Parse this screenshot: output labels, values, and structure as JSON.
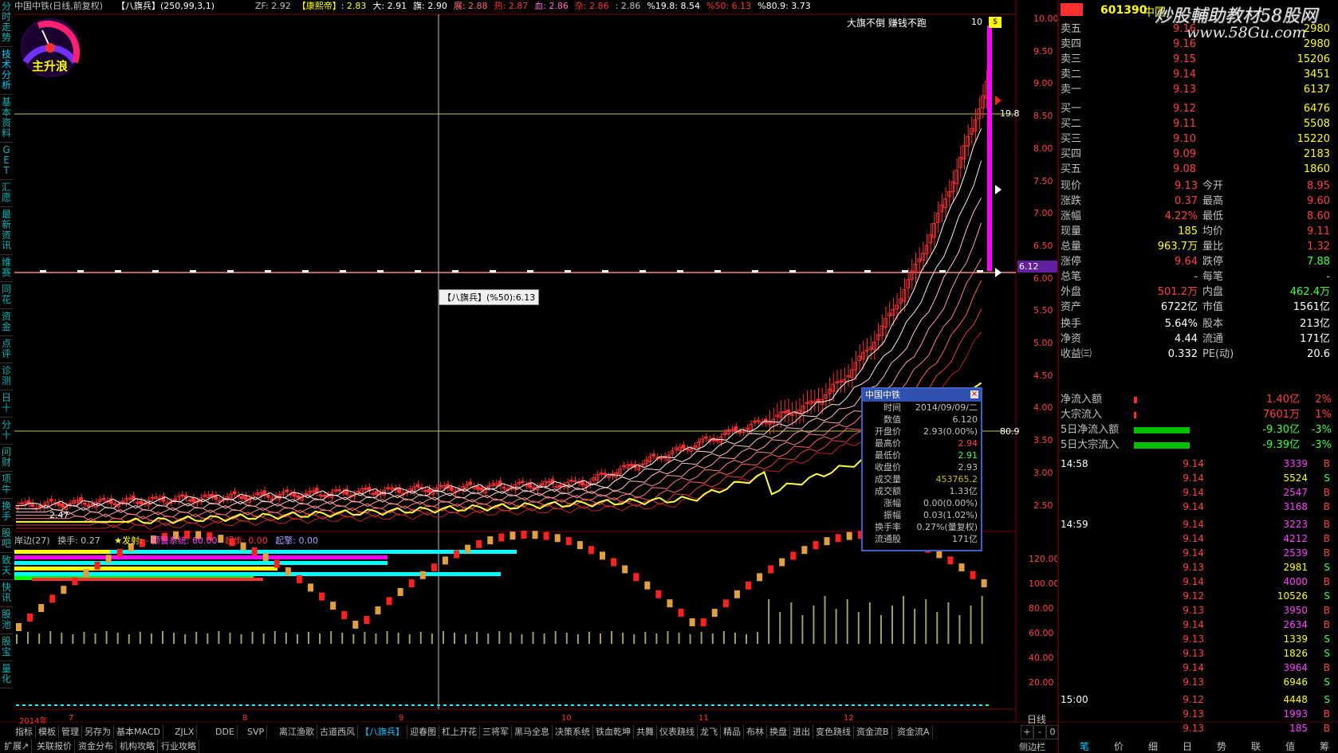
{
  "header": {
    "stock": "中国中铁(日线,前复权)",
    "indicator": "【八旗兵】(250,99,3,1)",
    "values": [
      {
        "label": "ZF",
        "value": "2.92",
        "color": "#c0c0c0"
      },
      {
        "label": "【康熙帝】",
        "value": "2.83",
        "color": "#ffff00"
      },
      {
        "label": "大",
        "value": "2.91",
        "color": "#ffffff"
      },
      {
        "label": "旗",
        "value": "2.90",
        "color": "#ffffff"
      },
      {
        "label": "展",
        "value": "2.88",
        "color": "#ff6666"
      },
      {
        "label": "热",
        "value": "2.87",
        "color": "#ff3030"
      },
      {
        "label": "血",
        "value": "2.86",
        "color": "#ff66cc"
      },
      {
        "label": "杂",
        "value": "2.86",
        "color": "#ff3030"
      },
      {
        "label": "",
        "value": "2.86",
        "color": "#c0c0c0"
      },
      {
        "label": "%19.8",
        "value": "8.54",
        "color": "#ffffff"
      },
      {
        "label": "%50",
        "value": "6.13",
        "color": "#ff3030"
      },
      {
        "label": "%80.9",
        "value": "3.73",
        "color": "#ffffff"
      }
    ]
  },
  "gauge": {
    "label": "主升浪"
  },
  "left_tabs": [
    "分时走势",
    "技术分析",
    "基本资料",
    "GET",
    "汇愿",
    "最新资讯",
    "维赛",
    "同花",
    "资金",
    "点评",
    "诊测",
    "日十",
    "分十",
    "问财",
    "项牛",
    "换手",
    "股吧",
    "致天",
    "快讯",
    "股池",
    "股宝",
    "量化"
  ],
  "price_axis": [
    "10.00",
    "9.50",
    "9.00",
    "8.50",
    "8.00",
    "7.50",
    "7.00",
    "6.50",
    "6.00",
    "5.50",
    "5.00",
    "4.50",
    "4.00",
    "3.50",
    "3.00",
    "2.50"
  ],
  "lower_axis": [
    "120.00",
    "100.00",
    "80.00",
    "60.00",
    "40.00",
    "20.00"
  ],
  "annotations": {
    "top_slogan": "大旗不倒 赚钱不跑",
    "max_label": "10",
    "max_tag": "$",
    "low_label": "2.47",
    "pct_19": "19.8",
    "pct_80": "80.9",
    "price_tag": "6.12",
    "crosshair_tip": "【八旗兵】(%50):6.13",
    "year_label": "2014年",
    "months": [
      "7",
      "8",
      "9",
      "10",
      "11",
      "12"
    ],
    "day_line": "日线"
  },
  "lower_header": {
    "a": "岸边(27)",
    "b": "换手: 0.27",
    "c": "★发射:",
    "d": "- 预警系统: 60.00",
    "e": "起步: 0.00",
    "f": "起擎: 0.00"
  },
  "popup": {
    "title": "中国中铁",
    "rows": [
      {
        "k": "时间",
        "v": "2014/09/09/二",
        "vc": "#c0c0c0"
      },
      {
        "k": "数值",
        "v": "6.120",
        "vc": "#c0c0c0"
      },
      {
        "k": "开盘价",
        "v": "2.93(0.00%)",
        "vc": "#c0c0c0"
      },
      {
        "k": "最高价",
        "v": "2.94",
        "vc": "#ff4040"
      },
      {
        "k": "最低价",
        "v": "2.91",
        "vc": "#40ff40"
      },
      {
        "k": "收盘价",
        "v": "2.93",
        "vc": "#c0c0c0"
      },
      {
        "k": "成交量",
        "v": "453765.2",
        "vc": "#c0c000"
      },
      {
        "k": "成交额",
        "v": "1.33亿",
        "vc": "#c0c0c0"
      },
      {
        "k": "涨幅",
        "v": "0.00(0.00%)",
        "vc": "#c0c0c0"
      },
      {
        "k": "振幅",
        "v": "0.03(1.02%)",
        "vc": "#c0c0c0"
      },
      {
        "k": "换手率",
        "v": "0.27%(量复权)",
        "vc": "#c0c0c0"
      },
      {
        "k": "流通股",
        "v": "171亿",
        "vc": "#c0c0c0"
      }
    ]
  },
  "quote": {
    "code": "601390",
    "name": "中国",
    "watermark_cn": "炒股輔助教材58股网",
    "watermark_url": "www.58Gu.com",
    "asks": [
      {
        "label": "卖五",
        "price": "9.16",
        "vol": "2980"
      },
      {
        "label": "卖四",
        "price": "9.16",
        "vol": "2980"
      },
      {
        "label": "卖三",
        "price": "9.15",
        "vol": "15206"
      },
      {
        "label": "卖二",
        "price": "9.14",
        "vol": "3451"
      },
      {
        "label": "卖一",
        "price": "9.13",
        "vol": "6137"
      }
    ],
    "bids": [
      {
        "label": "买一",
        "price": "9.12",
        "vol": "6476"
      },
      {
        "label": "买二",
        "price": "9.11",
        "vol": "5508"
      },
      {
        "label": "买三",
        "price": "9.10",
        "vol": "15220"
      },
      {
        "label": "买四",
        "price": "9.09",
        "vol": "2183"
      },
      {
        "label": "买五",
        "price": "9.08",
        "vol": "1860"
      }
    ],
    "stats": [
      {
        "l1": "现价",
        "v1": "9.13",
        "c1": "#ff4040",
        "l2": "今开",
        "v2": "8.95",
        "c2": "#ff4040"
      },
      {
        "l1": "涨跌",
        "v1": "0.37",
        "c1": "#ff4040",
        "l2": "最高",
        "v2": "9.60",
        "c2": "#ff4040"
      },
      {
        "l1": "涨幅",
        "v1": "4.22%",
        "c1": "#ff4040",
        "l2": "最低",
        "v2": "8.60",
        "c2": "#ff4040"
      },
      {
        "l1": "现量",
        "v1": "185",
        "c1": "#ffff00",
        "l2": "均价",
        "v2": "9.11",
        "c2": "#ff4040"
      },
      {
        "l1": "总量",
        "v1": "963.7万",
        "c1": "#ffff00",
        "l2": "量比",
        "v2": "1.32",
        "c2": "#ff4040"
      },
      {
        "l1": "涨停",
        "v1": "9.64",
        "c1": "#ff4040",
        "l2": "跌停",
        "v2": "7.88",
        "c2": "#40ff40"
      },
      {
        "l1": "总笔",
        "v1": "-",
        "c1": "#c0c0c0",
        "l2": "每笔",
        "v2": "-",
        "c2": "#c0c0c0"
      },
      {
        "l1": "外盘",
        "v1": "501.2万",
        "c1": "#ff4040",
        "l2": "内盘",
        "v2": "462.4万",
        "c2": "#40ff40"
      },
      {
        "l1": "资产",
        "v1": "6722亿",
        "c1": "#ffffff",
        "l2": "市值",
        "v2": "1561亿",
        "c2": "#ffffff"
      }
    ],
    "stats2": [
      {
        "l1": "换手",
        "v1": "5.64%",
        "l2": "股本",
        "v2": "213亿"
      },
      {
        "l1": "净资",
        "v1": "4.44",
        "l2": "流通",
        "v2": "171亿"
      },
      {
        "l1": "收益㈢",
        "v1": "0.332",
        "l2": "PE(动)",
        "v2": "20.6"
      }
    ],
    "flows": [
      {
        "label": "净流入额",
        "bar": 0.03,
        "color": "#ff3030",
        "value": "1.40亿",
        "vc": "#ff4040",
        "pct": "2%",
        "pc": "#ff4040"
      },
      {
        "label": "大宗流入",
        "bar": 0.02,
        "color": "#ff3030",
        "value": "7601万",
        "vc": "#ff4040",
        "pct": "1%",
        "pc": "#ff4040"
      },
      {
        "label": "5日净流入额",
        "bar": 0.5,
        "color": "#00c000",
        "value": "-9.30亿",
        "vc": "#40ff40",
        "pct": "-3%",
        "pc": "#40ff40"
      },
      {
        "label": "5日大宗流入",
        "bar": 0.5,
        "color": "#00c000",
        "value": "-9.39亿",
        "vc": "#40ff40",
        "pct": "-3%",
        "pc": "#40ff40"
      }
    ],
    "ticks": [
      {
        "time": "14:58",
        "price": "9.14",
        "vol": "3339",
        "side": "B"
      },
      {
        "time": "",
        "price": "9.14",
        "vol": "5524",
        "side": "S"
      },
      {
        "time": "",
        "price": "9.14",
        "vol": "2547",
        "side": "B"
      },
      {
        "time": "",
        "price": "9.14",
        "vol": "3168",
        "side": "B"
      },
      {
        "time": "14:59",
        "price": "9.14",
        "vol": "3223",
        "side": "B"
      },
      {
        "time": "",
        "price": "9.14",
        "vol": "4212",
        "side": "B"
      },
      {
        "time": "",
        "price": "9.14",
        "vol": "2539",
        "side": "B"
      },
      {
        "time": "",
        "price": "9.13",
        "vol": "2981",
        "side": "S"
      },
      {
        "time": "",
        "price": "9.14",
        "vol": "4000",
        "side": "B"
      },
      {
        "time": "",
        "price": "9.12",
        "vol": "10526",
        "side": "S"
      },
      {
        "time": "",
        "price": "9.13",
        "vol": "3950",
        "side": "B"
      },
      {
        "time": "",
        "price": "9.14",
        "vol": "2634",
        "side": "B"
      },
      {
        "time": "",
        "price": "9.13",
        "vol": "1339",
        "side": "S"
      },
      {
        "time": "",
        "price": "9.13",
        "vol": "1826",
        "side": "S"
      },
      {
        "time": "",
        "price": "9.14",
        "vol": "3964",
        "side": "B"
      },
      {
        "time": "",
        "price": "9.13",
        "vol": "6946",
        "side": "S"
      },
      {
        "time": "15:00",
        "price": "9.12",
        "vol": "4448",
        "side": "S"
      },
      {
        "time": "",
        "price": "9.13",
        "vol": "1993",
        "side": "B"
      },
      {
        "time": "",
        "price": "9.13",
        "vol": "185",
        "side": "B"
      }
    ]
  },
  "bottom_tabs": [
    "指标",
    "模板",
    "管理",
    "另存为",
    "基本MACD",
    "ZJLX",
    "DDE",
    "SVP",
    "离江渔歌",
    "古道西风",
    "【八旗兵】",
    "迎春图",
    "杠上开花",
    "三将军",
    "黑马全息",
    "决策系统",
    "铁血乾坤",
    "共舞",
    "仪表跷线",
    "龙飞",
    "精品",
    "布林",
    "换盘",
    "进出",
    "变色跷线",
    "资金流B",
    "资金流A"
  ],
  "bottom_active": "【八旗兵】",
  "footer_tabs": [
    "扩展↗",
    "关联报价",
    "资金分布",
    "机构攻略",
    "行业攻略"
  ],
  "right_tabs": [
    "笔",
    "价",
    "细",
    "日",
    "势",
    "联",
    "值",
    "筹"
  ],
  "side_label": "侧边栏",
  "zoom": [
    "+",
    "-",
    "0"
  ],
  "colors": {
    "up": "#ff3030",
    "down": "#00ff00",
    "ma": "#ffff40",
    "grid": "#800000",
    "cyan": "#00ffff",
    "magenta": "#ff00ff"
  }
}
